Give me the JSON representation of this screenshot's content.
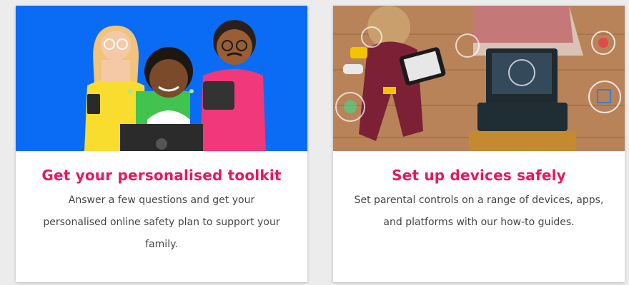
{
  "colors": {
    "accent": "#e8175d",
    "card_background": "#ffffff",
    "page_background": "#ececec",
    "toolkit_illustration_background": "#0a6cf5"
  },
  "cards": [
    {
      "illustration": "family-with-devices-illustration",
      "title": "Get your personalised toolkit",
      "description": "Answer a few questions and get your personalised online safety plan to support your family."
    },
    {
      "illustration": "children-using-tablet-and-laptop-photo",
      "title": "Set up devices safely",
      "description": "Set parental controls on a range of devices, apps, and platforms with our how-to guides."
    }
  ]
}
